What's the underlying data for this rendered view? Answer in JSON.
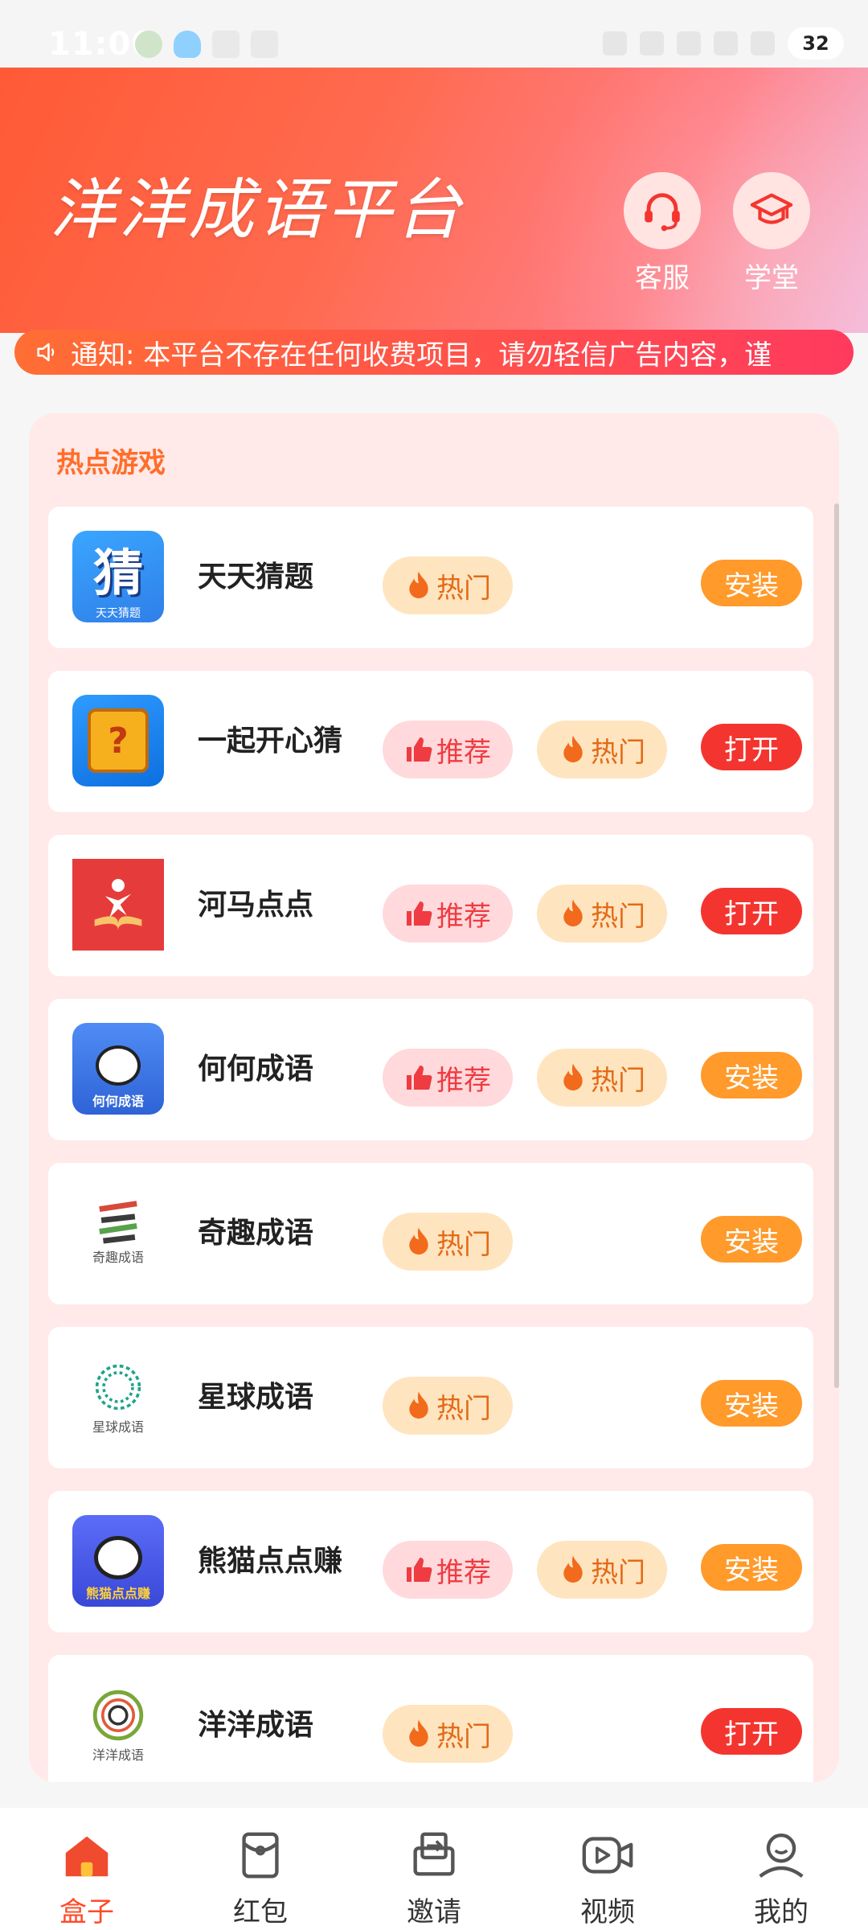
{
  "status_bar": {
    "time": "11:00",
    "battery": "32"
  },
  "header": {
    "title": "洋洋成语平台",
    "buttons": [
      {
        "label": "客服",
        "icon": "headset-icon"
      },
      {
        "label": "学堂",
        "icon": "graduation-cap-icon"
      }
    ]
  },
  "notice": {
    "text": "通知: 本平台不存在任何收费项目，请勿轻信广告内容，谨"
  },
  "section": {
    "title": "热点游戏"
  },
  "tags": {
    "recommend": "推荐",
    "hot": "热门"
  },
  "games": [
    {
      "name": "天天猜题",
      "recommend": false,
      "hot": true,
      "action": "安装",
      "logo_text": "猜",
      "logo_sub": "天天猜题"
    },
    {
      "name": "一起开心猜",
      "recommend": true,
      "hot": true,
      "action": "打开",
      "logo_text": "?",
      "logo_sub": ""
    },
    {
      "name": "河马点点",
      "recommend": true,
      "hot": true,
      "action": "打开",
      "logo_text": "",
      "logo_sub": ""
    },
    {
      "name": "何何成语",
      "recommend": true,
      "hot": true,
      "action": "安装",
      "logo_text": "",
      "logo_sub": "何何成语"
    },
    {
      "name": "奇趣成语",
      "recommend": false,
      "hot": true,
      "action": "安装",
      "logo_text": "",
      "logo_sub": "奇趣成语"
    },
    {
      "name": "星球成语",
      "recommend": false,
      "hot": true,
      "action": "安装",
      "logo_text": "",
      "logo_sub": "星球成语"
    },
    {
      "name": "熊猫点点赚",
      "recommend": true,
      "hot": true,
      "action": "安装",
      "logo_text": "",
      "logo_sub": "熊猫点点赚"
    },
    {
      "name": "洋洋成语",
      "recommend": false,
      "hot": true,
      "action": "打开",
      "logo_text": "",
      "logo_sub": "洋洋成语"
    }
  ],
  "bottom_nav": [
    {
      "label": "盒子",
      "icon": "home-box-icon",
      "active": true
    },
    {
      "label": "红包",
      "icon": "red-envelope-icon",
      "active": false
    },
    {
      "label": "邀请",
      "icon": "invite-icon",
      "active": false
    },
    {
      "label": "视频",
      "icon": "video-icon",
      "active": false
    },
    {
      "label": "我的",
      "icon": "profile-icon",
      "active": false
    }
  ],
  "colors": {
    "install": "#ff9a2b",
    "open": "#f4352f",
    "accent": "#ff4a2a"
  }
}
